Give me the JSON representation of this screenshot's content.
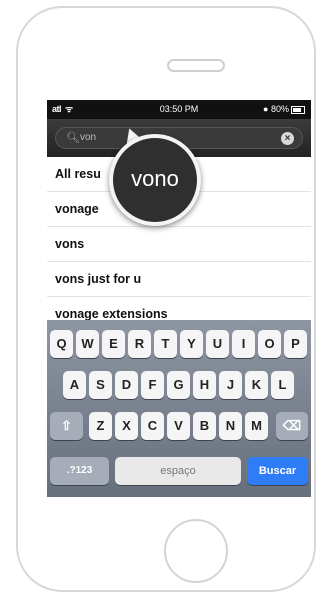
{
  "statusbar": {
    "signal": "atl",
    "wifi": "ᯤ",
    "time": "03:50 PM",
    "battery": "80%"
  },
  "search": {
    "value": "von",
    "magnifier": "vono"
  },
  "results": [
    "All resu",
    "vonage",
    "vons",
    "vons just for u",
    "vonage extensions"
  ],
  "keyboard": {
    "row1": [
      "Q",
      "W",
      "E",
      "R",
      "T",
      "Y",
      "U",
      "I",
      "O",
      "P"
    ],
    "row2": [
      "A",
      "S",
      "D",
      "F",
      "G",
      "H",
      "J",
      "K",
      "L"
    ],
    "row3": [
      "Z",
      "X",
      "C",
      "V",
      "B",
      "N",
      "M"
    ],
    "numbers_label": ".?123",
    "space_label": "espaço",
    "action_label": "Buscar"
  }
}
